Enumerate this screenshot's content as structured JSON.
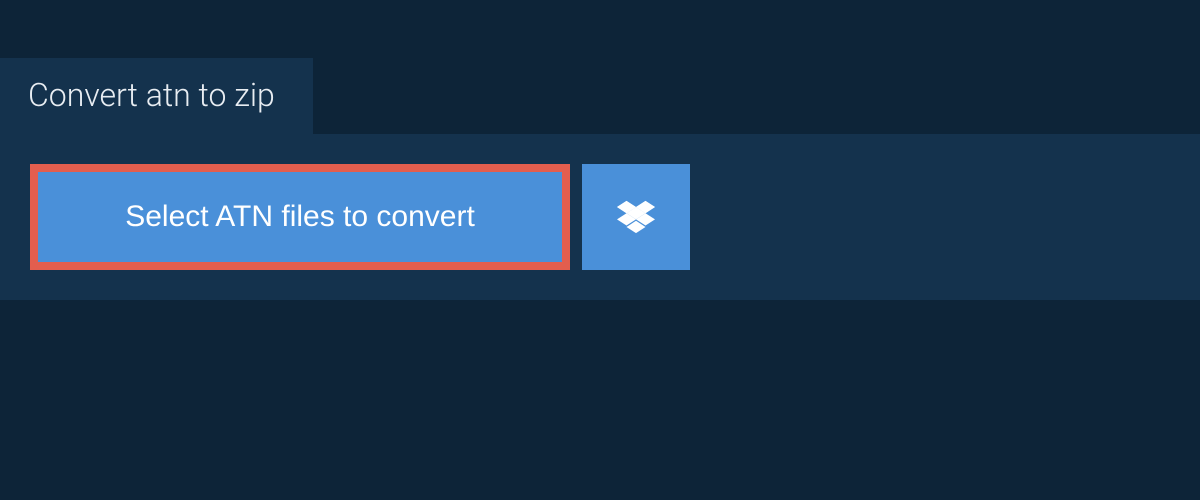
{
  "tab": {
    "label": "Convert atn to zip"
  },
  "actions": {
    "select_label": "Select ATN files to convert"
  },
  "colors": {
    "bg": "#0d2438",
    "panel": "#14324d",
    "button": "#4a90d9",
    "highlight_border": "#e35e4e"
  }
}
